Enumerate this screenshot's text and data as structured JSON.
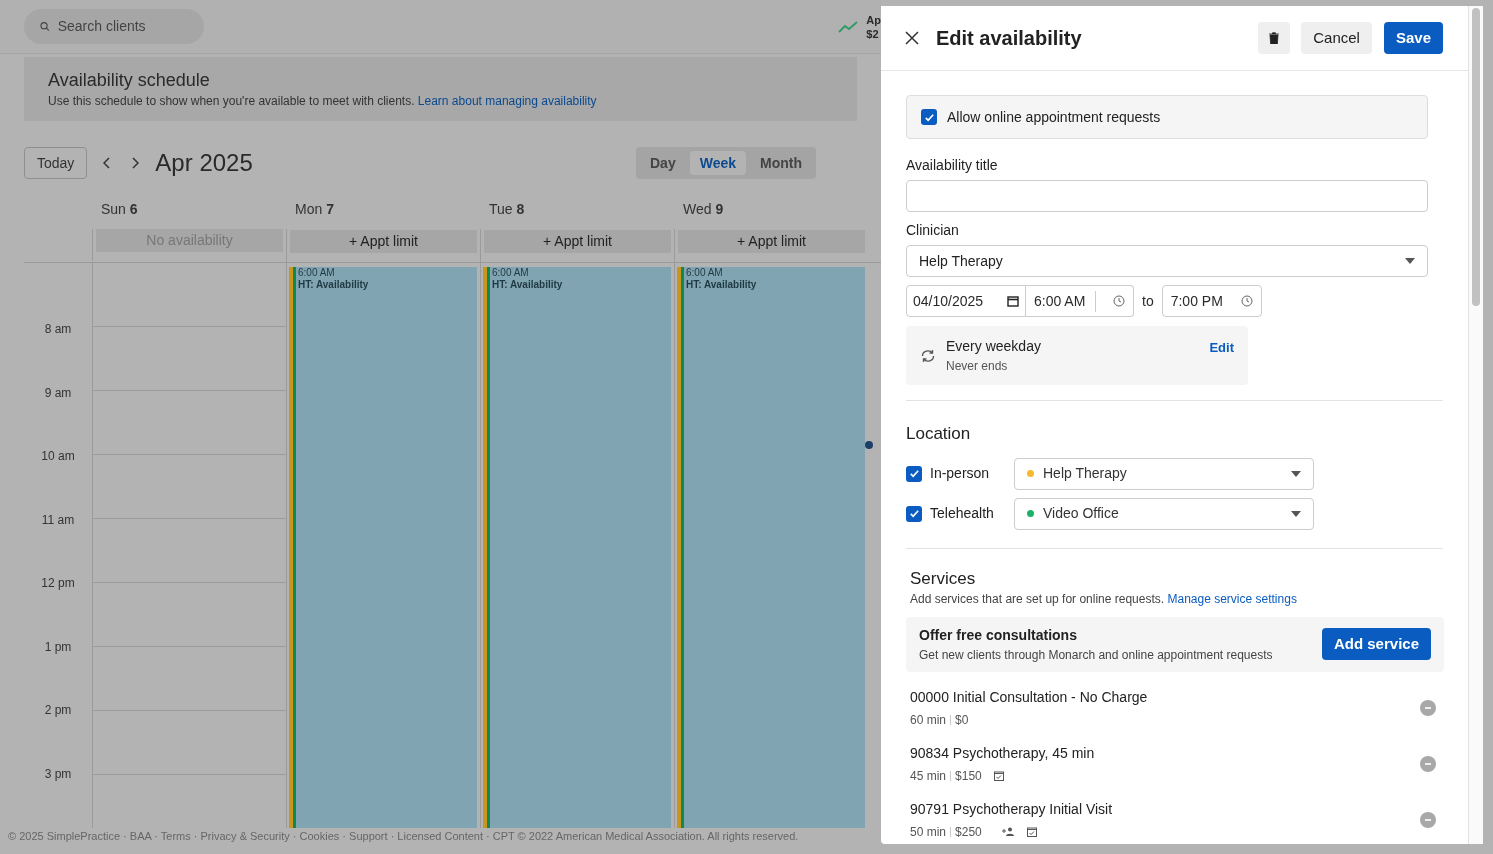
{
  "search": {
    "placeholder": "Search clients"
  },
  "stat": {
    "line_1": "Ap",
    "line_2": "$2"
  },
  "banner": {
    "title": "Availability schedule",
    "text": "Use this schedule to show when you're available to meet with clients.",
    "link": "Learn about managing availability"
  },
  "toolbar": {
    "today": "Today",
    "month": "Apr 2025"
  },
  "views": [
    {
      "label": "Day",
      "selected": false
    },
    {
      "label": "Week",
      "selected": true
    },
    {
      "label": "Month",
      "selected": false
    }
  ],
  "days": [
    {
      "name": "Sun",
      "num": "6",
      "kind": "none",
      "limit": "No availability"
    },
    {
      "name": "Mon",
      "num": "7",
      "kind": "available",
      "limit": "+ Appt limit",
      "event": {
        "time": "6:00 AM",
        "title": "HT: Availability"
      }
    },
    {
      "name": "Tue",
      "num": "8",
      "kind": "available",
      "limit": "+ Appt limit",
      "event": {
        "time": "6:00 AM",
        "title": "HT: Availability"
      }
    },
    {
      "name": "Wed",
      "num": "9",
      "kind": "available",
      "limit": "+ Appt limit",
      "event": {
        "time": "6:00 AM",
        "title": "HT: Availability"
      }
    }
  ],
  "hours": [
    "8 am",
    "9 am",
    "10 am",
    "11 am",
    "12 pm",
    "1 pm",
    "2 pm",
    "3 pm"
  ],
  "footer": "© 2025 SimplePractice · BAA · Terms · Privacy & Security · Cookies · Support · Licensed Content · CPT © 2022 American Medical Association. All rights reserved.",
  "panel": {
    "title": "Edit availability",
    "cancel": "Cancel",
    "save": "Save",
    "allow": {
      "label": "Allow online appointment requests",
      "checked": true
    },
    "title_field": {
      "label": "Availability title"
    },
    "clinician": {
      "label": "Clinician",
      "value": "Help Therapy"
    },
    "date": "04/10/2025",
    "start": "6:00 AM",
    "to": "to",
    "end": "7:00 PM",
    "recurrence": {
      "title": "Every weekday",
      "subtitle": "Never ends",
      "edit": "Edit"
    },
    "location": {
      "title": "Location",
      "items": [
        {
          "label": "In-person",
          "checked": true,
          "value": "Help Therapy",
          "color": "#f5b82e"
        },
        {
          "label": "Telehealth",
          "checked": true,
          "value": "Video Office",
          "color": "#1bb16a"
        }
      ]
    },
    "services": {
      "title": "Services",
      "text": "Add services that are set up for online requests.",
      "link": "Manage service settings",
      "promo": {
        "title": "Offer free consultations",
        "text": "Get new clients through Monarch and online appointment requests",
        "button": "Add service"
      },
      "items": [
        {
          "name": "00000 Initial Consultation - No Charge",
          "duration": "60 min",
          "price": "$0",
          "new_clients": false,
          "bookable": false
        },
        {
          "name": "90834 Psychotherapy, 45 min",
          "duration": "45 min",
          "price": "$150",
          "new_clients": false,
          "bookable": true
        },
        {
          "name": "90791 Psychotherapy Initial Visit",
          "duration": "50 min",
          "price": "$250",
          "new_clients": true,
          "bookable": true
        }
      ]
    }
  }
}
